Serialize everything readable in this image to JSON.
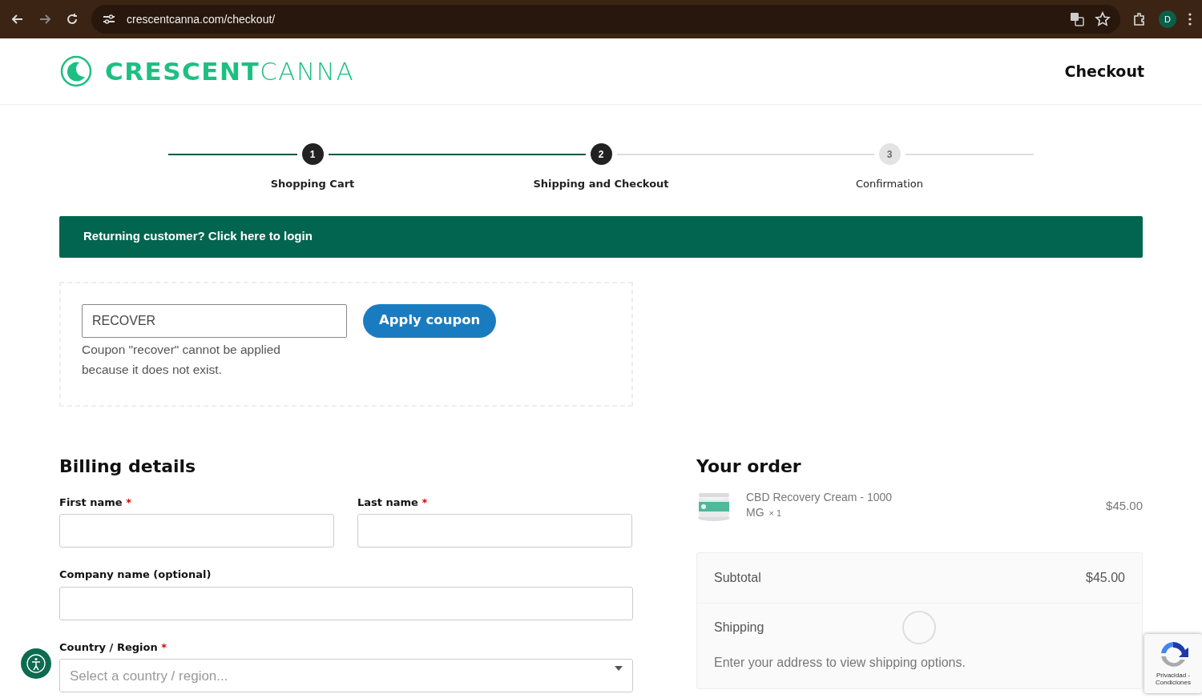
{
  "browser": {
    "url": "crescentcanna.com/checkout/",
    "profile_initial": "D"
  },
  "header": {
    "logo_bold": "CRESCENT",
    "logo_light": "CANNA",
    "title": "Checkout"
  },
  "steps": [
    {
      "number": "1",
      "label": "Shopping Cart",
      "completed": true
    },
    {
      "number": "2",
      "label": "Shipping and Checkout",
      "completed": true
    },
    {
      "number": "3",
      "label": "Confirmation",
      "completed": false
    }
  ],
  "login_notice": "Returning customer? Click here to login",
  "coupon": {
    "value": "RECOVER",
    "button": "Apply coupon",
    "error": "Coupon \"recover\" cannot be applied because it does not exist."
  },
  "billing": {
    "title": "Billing details",
    "required_mark": "*",
    "fields": [
      {
        "label": "First name",
        "required": true,
        "kind": "text",
        "half": true
      },
      {
        "label": "Last name",
        "required": true,
        "kind": "text",
        "half": true
      },
      {
        "label": "Company name (optional)",
        "required": false,
        "kind": "text",
        "half": false
      },
      {
        "label": "Country / Region",
        "required": true,
        "kind": "select",
        "half": false,
        "placeholder": "Select a country / region..."
      }
    ]
  },
  "order": {
    "title": "Your order",
    "items": [
      {
        "name": "CBD Recovery Cream - 1000 MG",
        "quantity": "× 1",
        "price": "$45.00"
      }
    ],
    "subtotal_label": "Subtotal",
    "subtotal": "$45.00",
    "shipping_label": "Shipping",
    "shipping_note": "Enter your address to view shipping options."
  },
  "recaptcha": {
    "text": "Privacidad - Condiciones"
  }
}
